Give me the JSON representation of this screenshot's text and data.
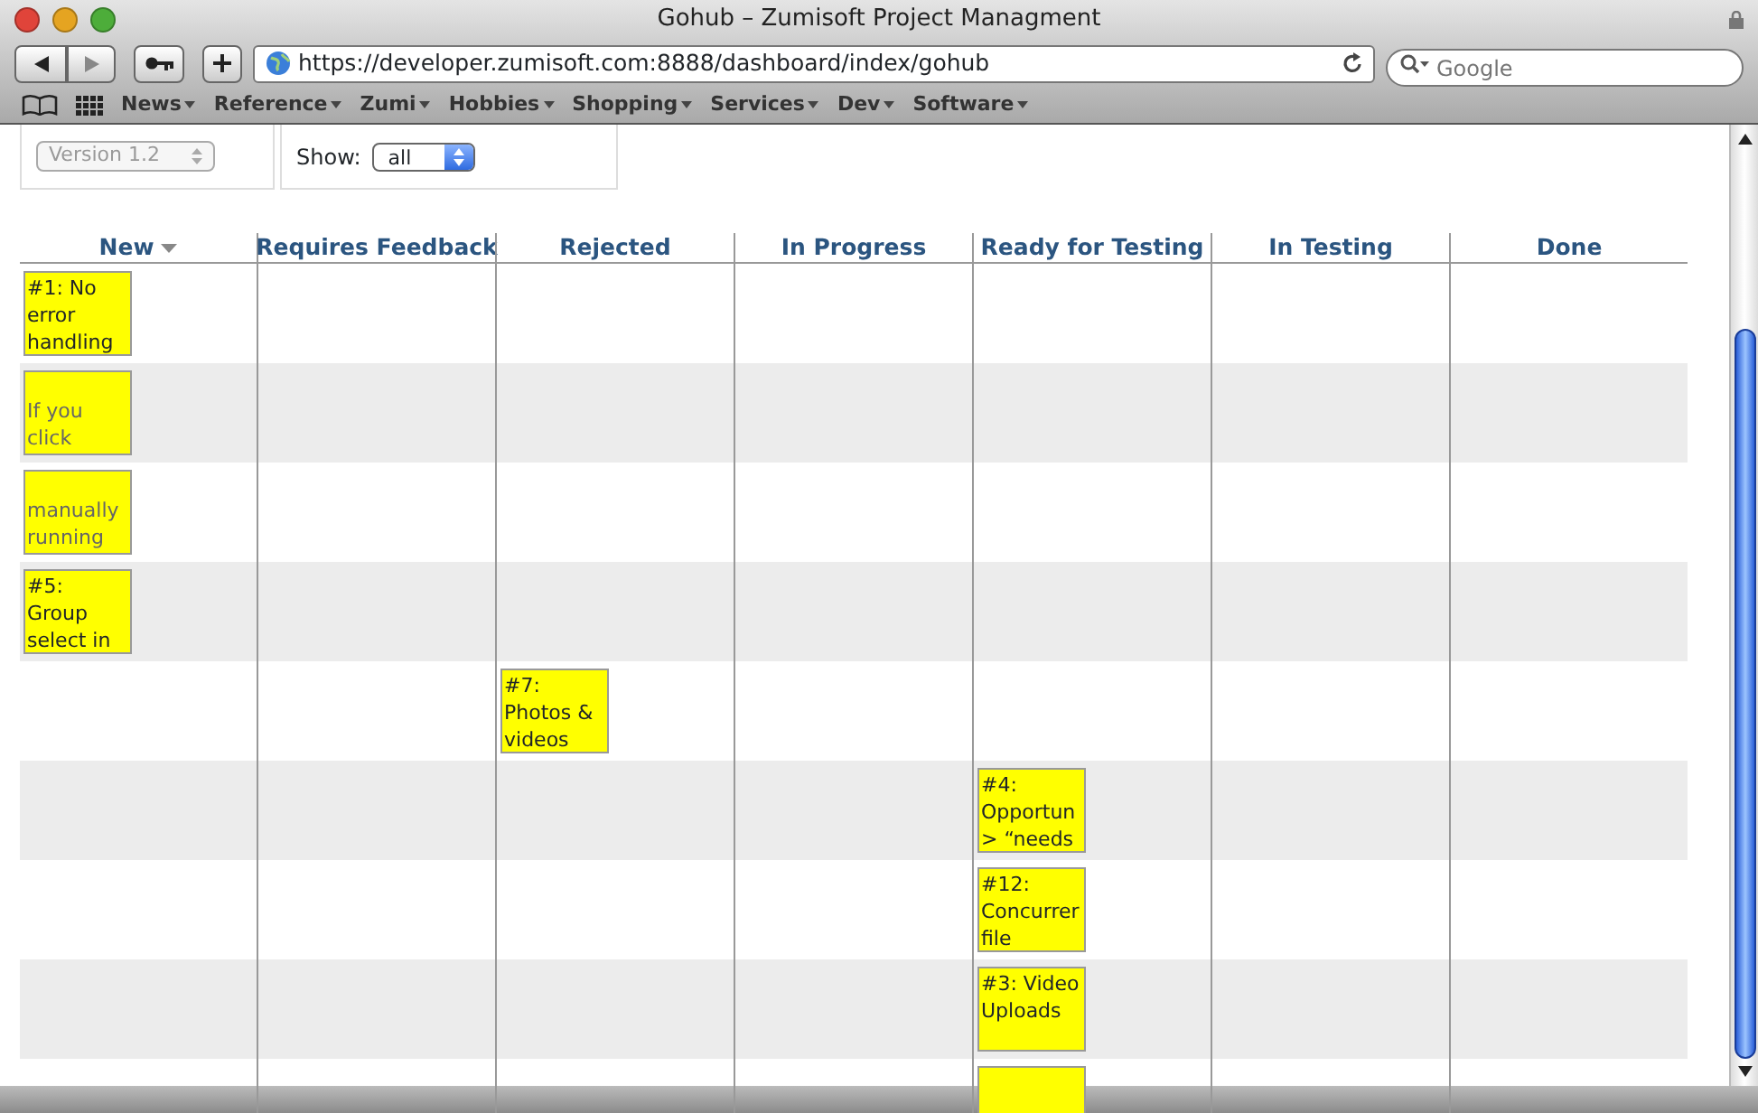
{
  "window": {
    "title": "Gohub – Zumisoft Project Managment"
  },
  "toolbar": {
    "url": "https://developer.zumisoft.com:8888/dashboard/index/gohub",
    "search": {
      "placeholder": "Google"
    }
  },
  "bookmarks": [
    "News",
    "Reference",
    "Zumi",
    "Hobbies",
    "Shopping",
    "Services",
    "Dev",
    "Software"
  ],
  "filters": {
    "version": {
      "value": "Version 1.2",
      "disabled": true
    },
    "show": {
      "label": "Show:",
      "value": "all"
    }
  },
  "board": {
    "columns": [
      {
        "title": "New",
        "sorted": true
      },
      {
        "title": "Requires Feedback",
        "sorted": false
      },
      {
        "title": "Rejected",
        "sorted": false
      },
      {
        "title": "In Progress",
        "sorted": false
      },
      {
        "title": "Ready for Testing",
        "sorted": false
      },
      {
        "title": "In Testing",
        "sorted": false
      },
      {
        "title": "Done",
        "sorted": false
      }
    ],
    "rows": [
      {
        "cells": [
          {
            "text": "#1: No error handling",
            "muted": false
          },
          null,
          null,
          null,
          null,
          null,
          null
        ]
      },
      {
        "cells": [
          {
            "text": "If you click",
            "muted": true
          },
          null,
          null,
          null,
          null,
          null,
          null
        ]
      },
      {
        "cells": [
          {
            "text": "manually running",
            "muted": true
          },
          null,
          null,
          null,
          null,
          null,
          null
        ]
      },
      {
        "cells": [
          {
            "text": "#5: Group select in",
            "muted": false
          },
          null,
          null,
          null,
          null,
          null,
          null
        ]
      },
      {
        "cells": [
          null,
          null,
          {
            "text": "#7: Photos & videos",
            "muted": false
          },
          null,
          null,
          null,
          null
        ]
      },
      {
        "cells": [
          null,
          null,
          null,
          null,
          {
            "text": "#4: Opportun > “needs",
            "muted": false
          },
          null,
          null
        ]
      },
      {
        "cells": [
          null,
          null,
          null,
          null,
          {
            "text": "#12: Concurrer file",
            "muted": false
          },
          null,
          null
        ]
      },
      {
        "cells": [
          null,
          null,
          null,
          null,
          {
            "text": "#3: Video Uploads",
            "muted": false
          },
          null,
          null
        ]
      },
      {
        "cells": [
          null,
          null,
          null,
          null,
          {},
          null,
          null
        ]
      }
    ]
  }
}
